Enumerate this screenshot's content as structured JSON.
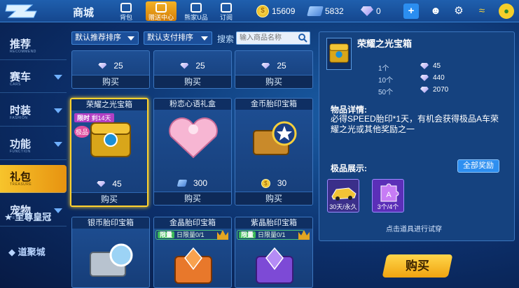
{
  "header": {
    "title": "商城",
    "nav": [
      {
        "label": "背包"
      },
      {
        "label": "赠送中心"
      },
      {
        "label": "熊家U品"
      },
      {
        "label": "订阅"
      }
    ],
    "coins": "15609",
    "tickets": "5832",
    "gems": "0"
  },
  "sidebar": {
    "items": [
      {
        "label": "推荐",
        "sub": "RECOMMEND"
      },
      {
        "label": "赛车",
        "sub": "CARS"
      },
      {
        "label": "时装",
        "sub": "FASHION"
      },
      {
        "label": "功能",
        "sub": "FUNCTION"
      },
      {
        "label": "礼包",
        "sub": "TREASURE"
      },
      {
        "label": "宠物",
        "sub": "PET"
      }
    ],
    "footer": [
      "至尊皇冠",
      "道聚城"
    ]
  },
  "filters": {
    "sort": "默认推荐排序",
    "pay": "默认支付排序",
    "search_label": "搜索",
    "search_placeholder": "输入商品名称"
  },
  "cards": [
    {
      "title": "",
      "price": "25",
      "buy": "购买"
    },
    {
      "title": "",
      "price": "25",
      "buy": "购买"
    },
    {
      "title": "",
      "price": "25",
      "buy": "购买"
    },
    {
      "title": "荣耀之光宝箱",
      "price": "45",
      "buy": "购买",
      "tag_limit": "限时",
      "tag_days": "剩14天",
      "tag_tier": "极品"
    },
    {
      "title": "粉恋心语礼盒",
      "price": "300",
      "buy": "购买"
    },
    {
      "title": "金币胎印宝箱",
      "price": "30",
      "buy": "购买"
    },
    {
      "title": "银币胎印宝箱"
    },
    {
      "title": "金晶胎印宝箱",
      "limit_tag": "限量",
      "limit_text": "日限量0/1"
    },
    {
      "title": "紫晶胎印宝箱",
      "limit_tag": "限量",
      "limit_text": "日限量0/1"
    }
  ],
  "panel": {
    "title": "荣耀之光宝箱",
    "tiers": [
      {
        "qty": "1个",
        "price": "45"
      },
      {
        "qty": "10个",
        "price": "440"
      },
      {
        "qty": "50个",
        "price": "2070"
      }
    ],
    "detail_h": "物品详情:",
    "detail": "必得SPEED胎印*1天，有机会获得极品A车荣耀之光或其他奖励之一",
    "show_h": "极品展示:",
    "all_btn": "全部奖励",
    "show_items": [
      {
        "cap": "30天/永久"
      },
      {
        "cap": "3个/4个"
      }
    ],
    "hint": "点击道具进行试穿",
    "buy": "购买"
  },
  "colors": {
    "accent": "#f0a410",
    "select": "#ffd22e",
    "bg": "#0c2f6a"
  }
}
